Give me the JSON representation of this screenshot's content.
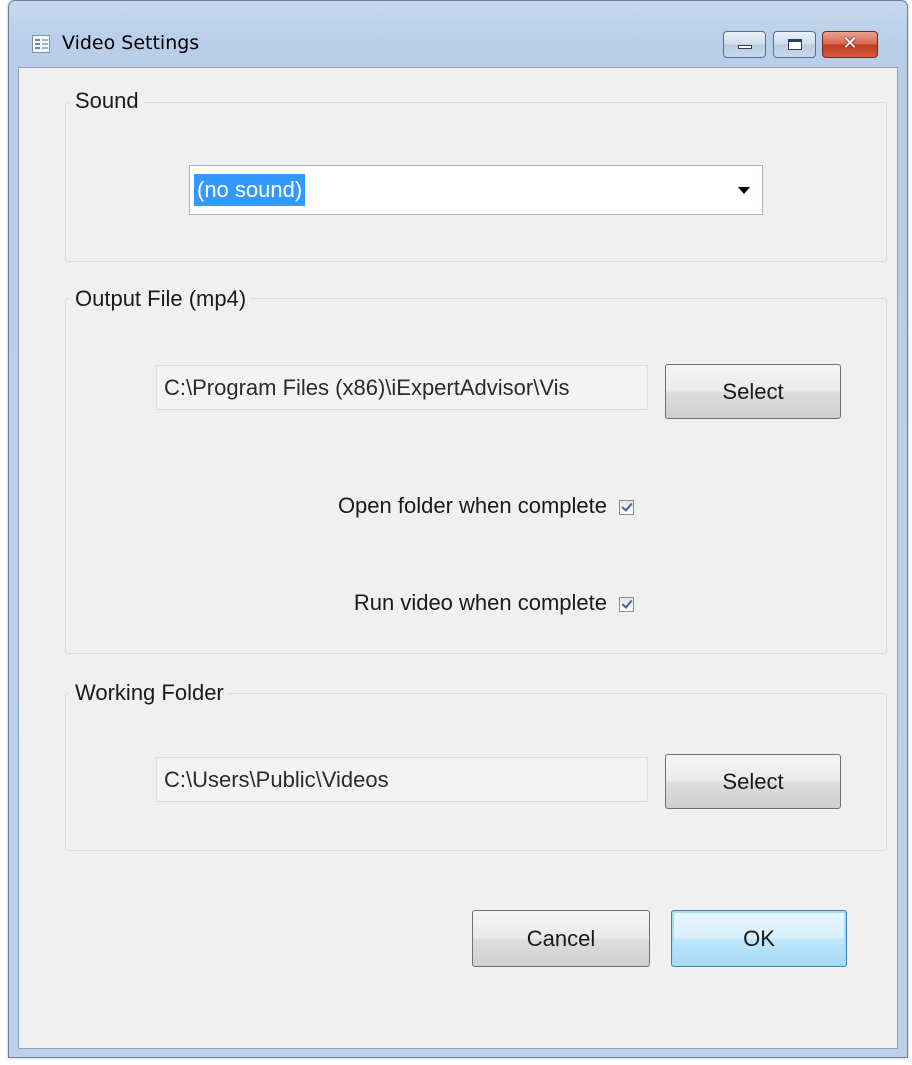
{
  "window": {
    "title": "Video Settings",
    "icon": "form-window-icon",
    "controls": {
      "minimize": "minimize-icon",
      "maximize": "maximize-icon",
      "close": "✕"
    }
  },
  "sound": {
    "group_label": "Sound",
    "selected": "(no sound)"
  },
  "output": {
    "group_label": "Output File (mp4)",
    "path": "C:\\Program Files (x86)\\iExpertAdvisor\\Vis",
    "select_label": "Select",
    "open_folder_label": "Open folder when complete",
    "open_folder_checked": true,
    "run_video_label": "Run video when complete",
    "run_video_checked": true
  },
  "working": {
    "group_label": "Working Folder",
    "path": "C:\\Users\\Public\\Videos",
    "select_label": "Select"
  },
  "footer": {
    "cancel_label": "Cancel",
    "ok_label": "OK"
  },
  "colors": {
    "selection": "#3399ff",
    "ok_border": "#3c7fb1",
    "close_button": "#c23b1f"
  }
}
